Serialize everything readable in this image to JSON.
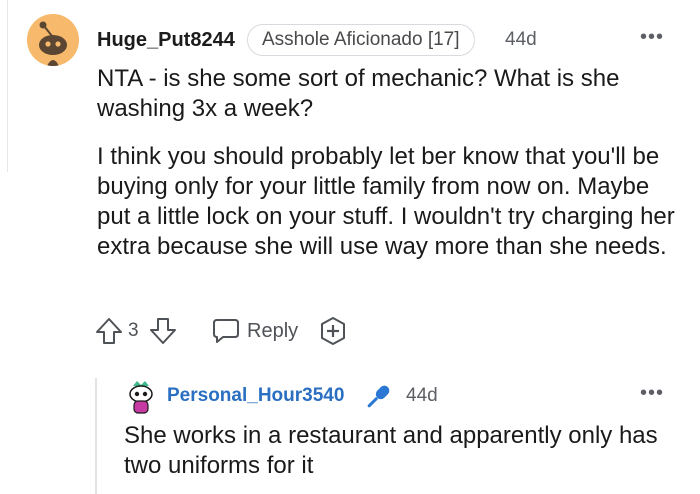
{
  "comment": {
    "author": "Huge_Put8244",
    "flair": "Asshole Aficionado [17]",
    "time": "44d",
    "more_label": "•••",
    "paragraphs": [
      "NTA - is she some sort of mechanic? What is she washing 3x a week?",
      "I think you should probably let ber know that you'll be buying only for your little family from now on. Maybe put a little lock on your stuff. I wouldn't try charging her extra because she will use way more than she needs."
    ],
    "score": "3",
    "reply_label": "Reply"
  },
  "reply": {
    "author": "Personal_Hour3540",
    "time": "44d",
    "more_label": "•••",
    "text": "She works in a restaurant and apparently only has two uniforms for it"
  },
  "colors": {
    "avatar_bg": "#f7b96b",
    "reply_author": "#2a6fc1",
    "mic_icon": "#2a78d4"
  },
  "icons": [
    "reddit-snoo-avatar-icon",
    "upvote-arrow-icon",
    "downvote-arrow-icon",
    "speech-bubble-icon",
    "add-award-icon",
    "microphone-icon",
    "snoo-avatar-icon"
  ]
}
